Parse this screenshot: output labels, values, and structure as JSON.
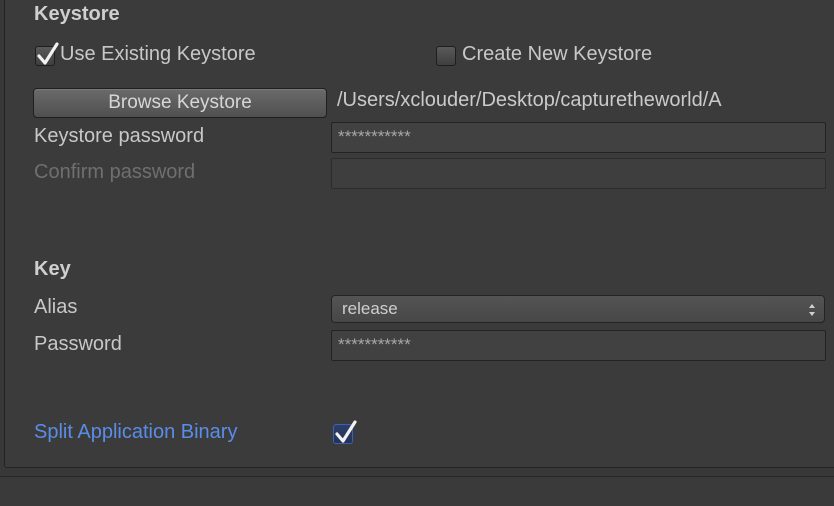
{
  "keystore": {
    "header": "Keystore",
    "use_existing_label": "Use Existing Keystore",
    "use_existing_checked": true,
    "create_new_label": "Create New Keystore",
    "create_new_checked": false,
    "browse_button_label": "Browse Keystore",
    "path": "/Users/xclouder/Desktop/capturetheworld/A",
    "password_label": "Keystore password",
    "password_value": "***********",
    "confirm_label": "Confirm password",
    "confirm_value": ""
  },
  "key": {
    "header": "Key",
    "alias_label": "Alias",
    "alias_value": "release",
    "password_label": "Password",
    "password_value": "***********"
  },
  "split": {
    "label": "Split Application Binary",
    "checked": true
  },
  "colors": {
    "background": "#383838",
    "link_label": "#5a8de8",
    "checkbox_active_border": "#3d5fb5"
  },
  "icons": {
    "checkmark": "checkmark-icon",
    "dropdown_arrows": "updown-arrows-icon"
  }
}
